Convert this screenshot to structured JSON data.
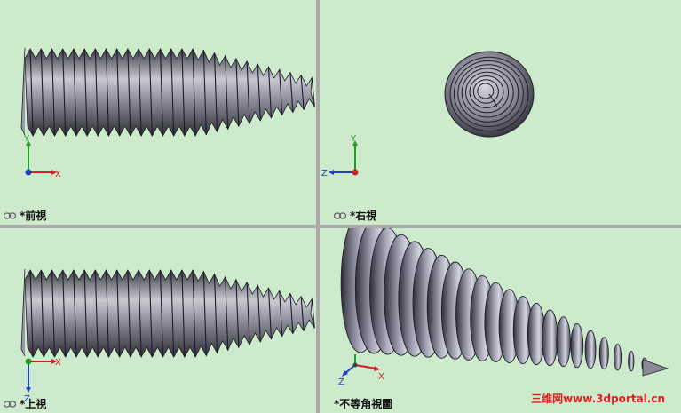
{
  "viewports": {
    "front": {
      "label": "*前視",
      "axes": {
        "up": "Y",
        "right": "X"
      }
    },
    "right": {
      "label": "*右視",
      "axes": {
        "up": "Y",
        "left": "Z"
      }
    },
    "top": {
      "label": "*上視",
      "axes": {
        "down": "Z",
        "right": "X"
      }
    },
    "iso": {
      "label": "*不等角視圖",
      "axes": {
        "up": "Y",
        "left": "Z",
        "right": "X"
      }
    }
  },
  "watermark": "三维网www.3dportal.cn",
  "colors": {
    "viewport_bg": "#cdeacd",
    "divider": "#a9a9a9",
    "x_axis": "#d02020",
    "y_axis": "#20a020",
    "z_axis": "#2040c0",
    "watermark": "#e02020"
  }
}
